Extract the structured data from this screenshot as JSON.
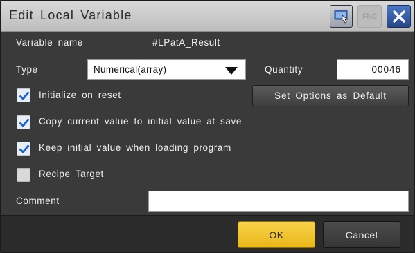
{
  "dialog": {
    "title": "Edit  Local  Variable",
    "titlebar_buttons": {
      "touch_icon": "touch-keypad-icon",
      "fnc_label": "FNC",
      "close_icon": "close-icon"
    }
  },
  "form": {
    "variable_name_label": "Variable name",
    "variable_name_value": "#LPatA_Result",
    "type_label": "Type",
    "type_value": "Numerical(array)",
    "quantity_label": "Quantity",
    "quantity_value": "00046",
    "set_default_label": "Set Options as Default",
    "options": [
      {
        "label": "Initialize on reset",
        "checked": true
      },
      {
        "label": "Copy current value to initial value at save",
        "checked": true
      },
      {
        "label": "Keep initial value when loading program",
        "checked": true
      },
      {
        "label": "Recipe Target",
        "checked": false
      }
    ],
    "comment_label": "Comment",
    "comment_value": ""
  },
  "footer": {
    "ok_label": "OK",
    "cancel_label": "Cancel"
  },
  "colors": {
    "ok_accent": "#f2c733",
    "close_accent": "#3a62b0",
    "checkmark": "#1f62c9"
  }
}
